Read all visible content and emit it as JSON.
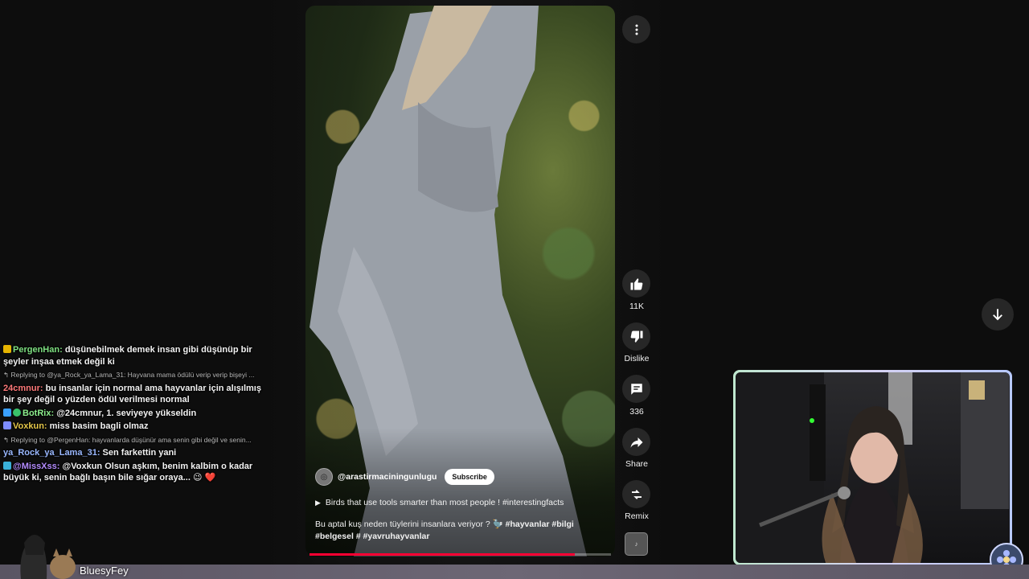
{
  "chat": {
    "messages": [
      {
        "kind": "msg",
        "user": "PergenHan",
        "color": "#7ee081",
        "badge": "#e6b400",
        "text": "düşünebilmek demek insan gibi düşünüp bir şeyler inşaa etmek değil ki"
      },
      {
        "kind": "reply",
        "text": "↰ Replying to @ya_Rock_ya_Lama_31: Hayvana mama ödülü verip verip bişeyi ..."
      },
      {
        "kind": "msg",
        "user": "24cmnur",
        "color": "#ff7a7a",
        "badge": "",
        "text": "bu insanlar için normal ama hayvanlar için alışılmış bir şey değil o yüzden ödül verilmesi normal"
      },
      {
        "kind": "msg",
        "user": "BotRix",
        "color": "#8ef08e",
        "badge": "#3aa0ff",
        "badge2": "#39c26a",
        "text": "@24cmnur, 1. seviyeye yükseldin"
      },
      {
        "kind": "msg",
        "user": "Voxkun",
        "color": "#e6c84a",
        "badge": "#7d8cff",
        "text": "miss basim bagli olmaz"
      },
      {
        "kind": "reply",
        "text": "↰ Replying to @PergenHan: hayvanlarda düşünür ama senin gibi değil ve senin..."
      },
      {
        "kind": "msg",
        "user": "ya_Rock_ya_Lama_31",
        "color": "#9ab8ff",
        "badge": "",
        "text": "Sen farkettin yani"
      },
      {
        "kind": "msg",
        "user": "@MissXss",
        "color": "#b48cff",
        "badge": "#3ab0d8",
        "text": "@Voxkun Olsun aşkım, benim kalbim o kadar büyük ki, senin bağlı başın bile sığar oraya... 😉 ❤️"
      }
    ]
  },
  "video": {
    "channel_handle": "@arastirmaciningunlugu",
    "subscribe_label": "Subscribe",
    "title": "Birds that use tools smarter than most people ! #interestingfacts",
    "description_plain": "Bu aptal kuş neden tüylerini insanlara veriyor ? 🦤 ",
    "description_tags": "#hayvanlar #bilgi #belgesel # #yavruhayvanlar",
    "progress": 0.88
  },
  "actions": {
    "like_count": "11K",
    "dislike_label": "Dislike",
    "comment_count": "336",
    "share_label": "Share",
    "remix_label": "Remix"
  },
  "streamer": {
    "name": "BluesyFey"
  },
  "colors": {
    "progress_red": "#ff0033",
    "cam_border": "#c9d6ff"
  }
}
